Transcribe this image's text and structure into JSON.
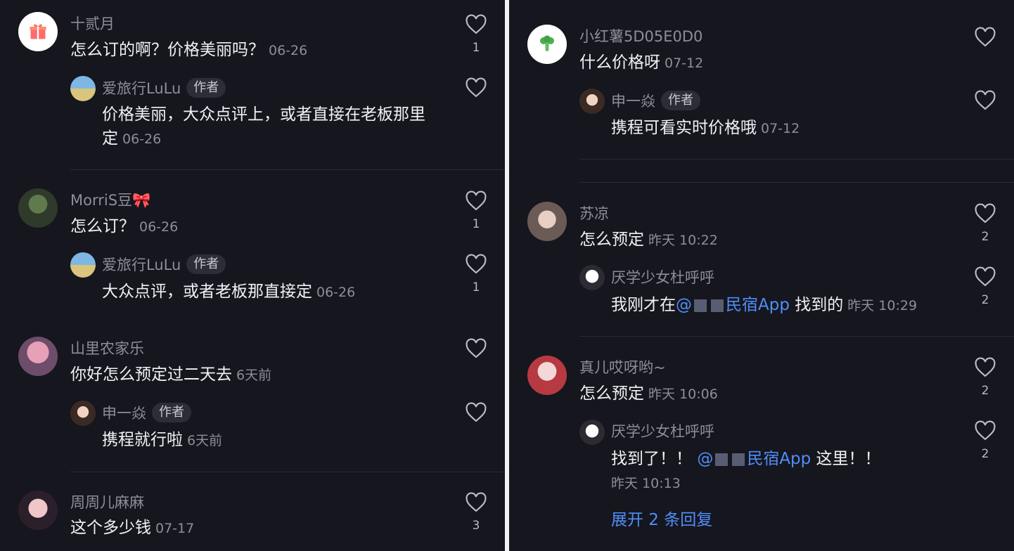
{
  "left": {
    "threads": [
      {
        "user": "十贰月",
        "text": "怎么订的啊？价格美丽吗？",
        "time": "06-26",
        "likes": "1",
        "reply": {
          "user": "爱旅行LuLu",
          "tag": "作者",
          "text": "价格美丽，大众点评上，或者直接在老板那里定",
          "time": "06-26",
          "likes": ""
        }
      },
      {
        "user": "MorriS豆🎀",
        "text": "怎么订？",
        "time": "06-26",
        "likes": "1",
        "reply": {
          "user": "爱旅行LuLu",
          "tag": "作者",
          "text": "大众点评，或者老板那直接定",
          "time": "06-26",
          "likes": "1"
        }
      },
      {
        "user": "山里农家乐",
        "text": "你好怎么预定过二天去",
        "time": "6天前",
        "likes": "",
        "reply": {
          "user": "申一焱",
          "tag": "作者",
          "text": "携程就行啦",
          "time": "6天前",
          "likes": ""
        }
      },
      {
        "user": "周周儿麻麻",
        "text": "这个多少钱",
        "time": "07-17",
        "likes": "3"
      }
    ]
  },
  "right": {
    "threads": [
      {
        "user": "小红薯5D05E0D0",
        "text": "什么价格呀",
        "time": "07-12",
        "likes": "",
        "reply": {
          "user": "申一焱",
          "tag": "作者",
          "text": "携程可看实时价格哦",
          "time": "07-12",
          "likes": ""
        }
      },
      {
        "user": "苏凉",
        "text": "怎么预定",
        "time": "昨天 10:22",
        "likes": "2",
        "reply": {
          "user": "厌学少女杜呼呼",
          "text_pre": "我刚才在",
          "mention_at": "@",
          "mention": "民宿App",
          "text_post": " 找到的",
          "time": "昨天 10:29",
          "likes": "2"
        }
      },
      {
        "user": "真儿哎呀哟~",
        "text": "怎么预定",
        "time": "昨天 10:06",
        "likes": "2",
        "reply": {
          "user": "厌学少女杜呼呼",
          "text_pre": "找到了！！ ",
          "mention_at": "@",
          "mention": "民宿App",
          "text_post": " 这里！！",
          "time": "昨天 10:13",
          "likes": "2"
        },
        "expand": "展开 2 条回复"
      }
    ]
  }
}
